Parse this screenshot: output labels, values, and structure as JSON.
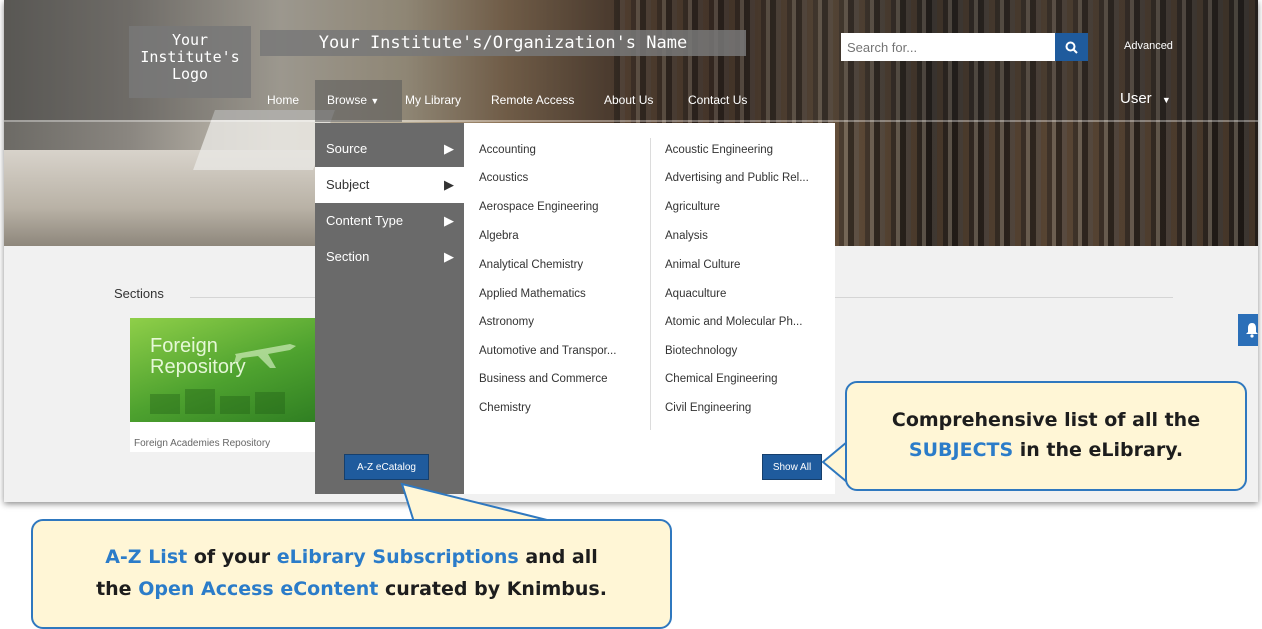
{
  "header": {
    "logo_lines": [
      "Your",
      "Institute's",
      "Logo"
    ],
    "org_name": "Your Institute's/Organization's Name",
    "search_placeholder": "Search for...",
    "advanced_label": "Advanced",
    "user_label": "User"
  },
  "nav": {
    "items": [
      "Home",
      "Browse",
      "My Library",
      "Remote Access",
      "About Us",
      "Contact Us"
    ]
  },
  "browse_menu": {
    "categories": [
      "Source",
      "Subject",
      "Content Type",
      "Section"
    ],
    "active": "Subject",
    "az_button": "A-Z eCatalog",
    "show_all_button": "Show All",
    "subjects_col1": [
      "Accounting",
      "Acoustics",
      "Aerospace Engineering",
      "Algebra",
      "Analytical Chemistry",
      "Applied Mathematics",
      "Astronomy",
      "Automotive and Transpor...",
      "Business and Commerce",
      "Chemistry"
    ],
    "subjects_col2": [
      "Acoustic Engineering",
      "Advertising and Public Rel...",
      "Agriculture",
      "Analysis",
      "Animal Culture",
      "Aquaculture",
      "Atomic and Molecular Ph...",
      "Biotechnology",
      "Chemical Engineering",
      "Civil Engineering"
    ]
  },
  "main": {
    "sections_label": "Sections",
    "card_image_lines": [
      "Foreign",
      "Repository"
    ],
    "card_caption": "Foreign Academies Repository"
  },
  "callouts": {
    "subjects": {
      "line1": "Comprehensive list of all the",
      "hl": "SUBJECTS",
      "line2_rest": " in the eLibrary."
    },
    "az": {
      "hl1": "A-Z List",
      "t1": " of your ",
      "hl2": "eLibrary Subscriptions",
      "t2": " and all",
      "t3": "the ",
      "hl3": "Open Access eContent",
      "t4": " curated by Knimbus."
    }
  },
  "colors": {
    "accent": "#1f5b9d",
    "callout_bg": "#fff6d6",
    "callout_border": "#2f78bf",
    "highlight_text": "#2b7cc9"
  }
}
